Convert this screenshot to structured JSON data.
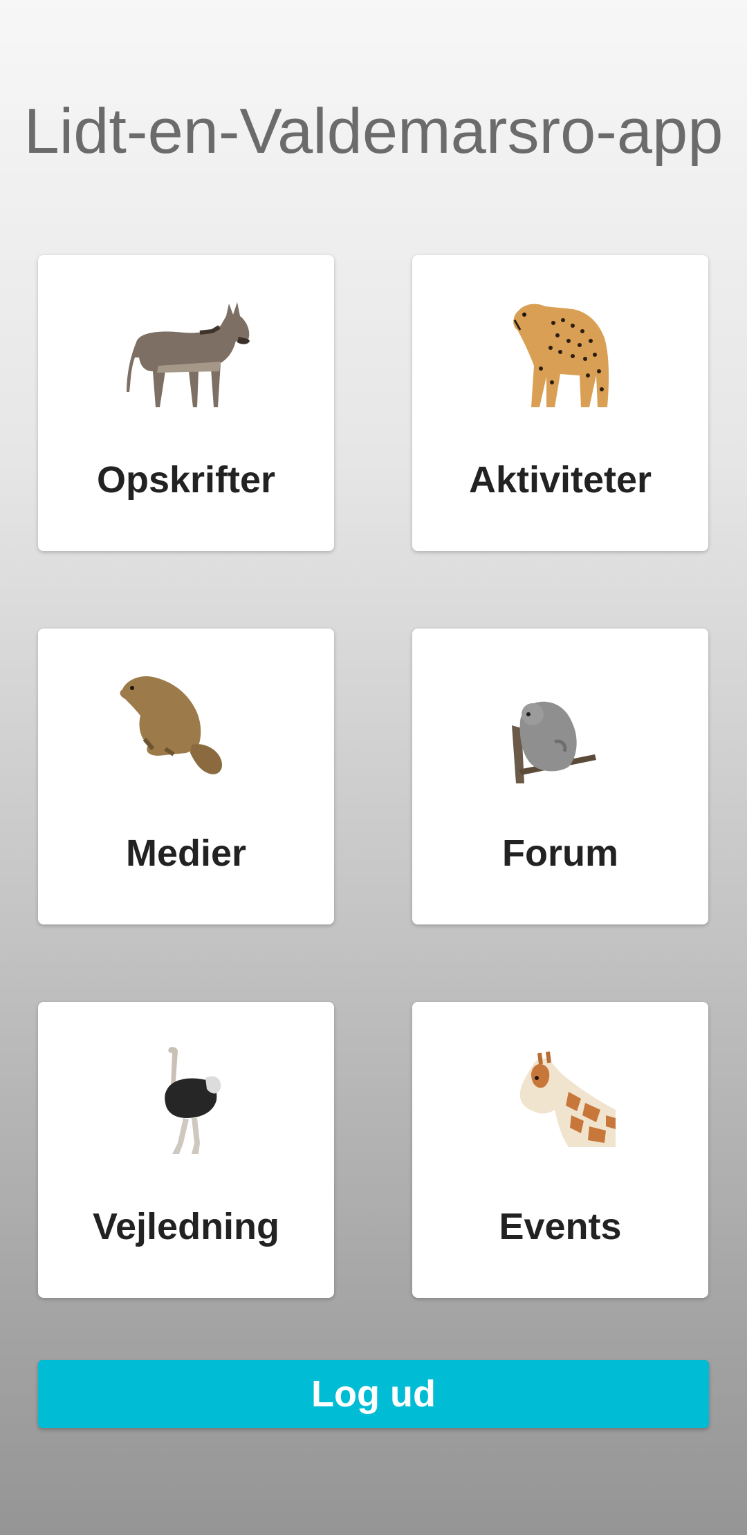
{
  "app": {
    "title": "Lidt-en-Valdemarsro-app"
  },
  "tiles": [
    {
      "label": "Opskrifter",
      "icon": "donkey-icon"
    },
    {
      "label": "Aktiviteter",
      "icon": "cheetah-icon"
    },
    {
      "label": "Medier",
      "icon": "marmot-icon"
    },
    {
      "label": "Forum",
      "icon": "koala-icon"
    },
    {
      "label": "Vejledning",
      "icon": "ostrich-icon"
    },
    {
      "label": "Events",
      "icon": "giraffe-icon"
    }
  ],
  "logout": {
    "label": "Log ud"
  },
  "colors": {
    "accent": "#00bcd4",
    "title_text": "#6b6b6b",
    "tile_text": "#222222",
    "tile_bg": "#ffffff"
  }
}
